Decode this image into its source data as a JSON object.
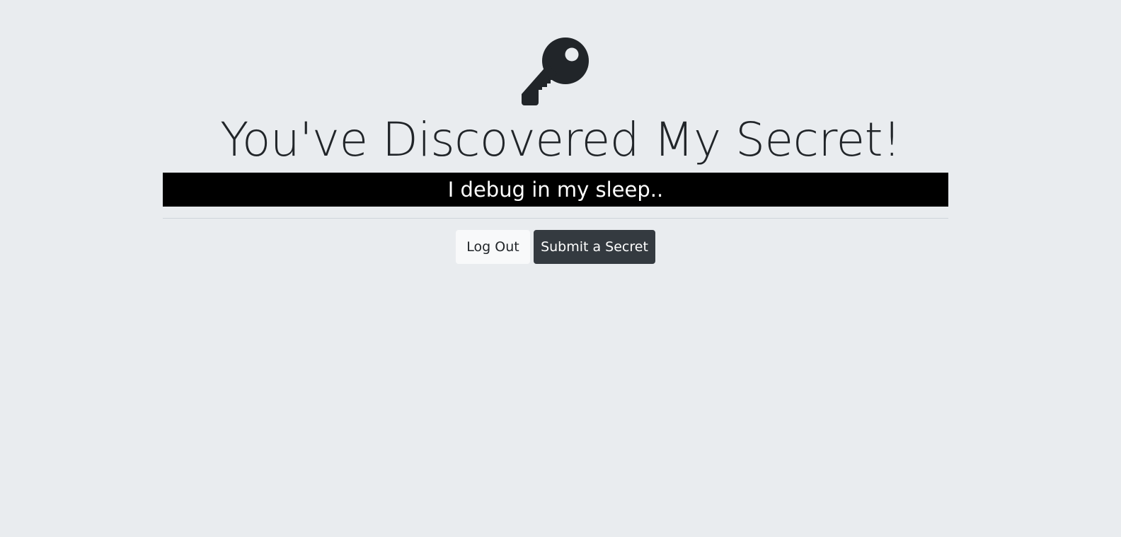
{
  "page": {
    "title": "You've Discovered My Secret!",
    "secret_text": "I debug in my sleep..",
    "icon": "key-icon",
    "background_color": "#e9ecef",
    "text_color": "#212529"
  },
  "actions": {
    "logout_label": "Log Out",
    "submit_label": "Submit a Secret",
    "logout_color": "#f8f9fa",
    "submit_color": "#343a40"
  },
  "secret_bar": {
    "background_color": "#000000",
    "text_color": "#ffffff"
  }
}
